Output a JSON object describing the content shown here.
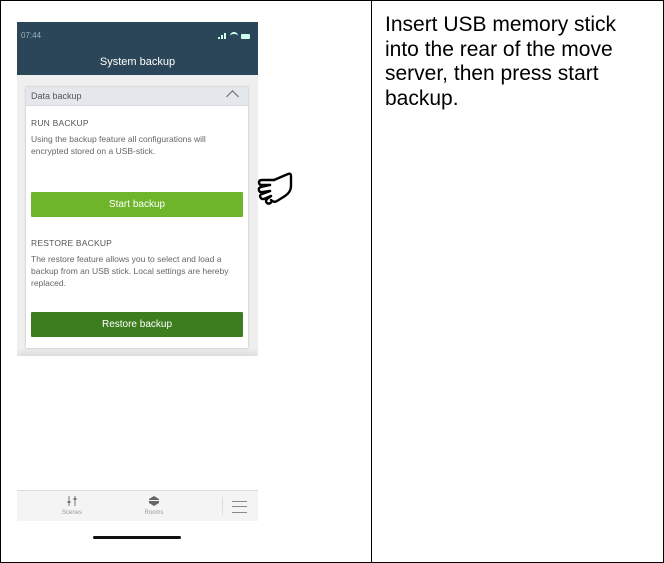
{
  "phone": {
    "status": {
      "time": "07:44"
    },
    "appbar": {
      "title": "System backup"
    },
    "card": {
      "header": "Data backup",
      "run": {
        "title": "RUN BACKUP",
        "text": "Using the backup feature all configurations will encrypted stored on a USB-stick.",
        "button": "Start backup"
      },
      "restore": {
        "title": "RESTORE BACKUP",
        "text": "The restore feature allows you to select and load a backup from an USB stick. Local settings are hereby replaced.",
        "button": "Restore backup"
      }
    },
    "tabbar": {
      "tabs": [
        {
          "label": "Scenes",
          "icon": "scenes-icon"
        },
        {
          "label": "Rooms",
          "icon": "rooms-icon"
        }
      ],
      "menu_icon": "hamburger-menu-icon"
    }
  },
  "pointer": {
    "icon": "pointing-hand-icon"
  },
  "instruction": "Insert USB memory stick into the rear of the move server, then press start backup.",
  "colors": {
    "appbar": "#2b4658",
    "start_button": "#6fb52c",
    "restore_button": "#3e7d1f"
  }
}
